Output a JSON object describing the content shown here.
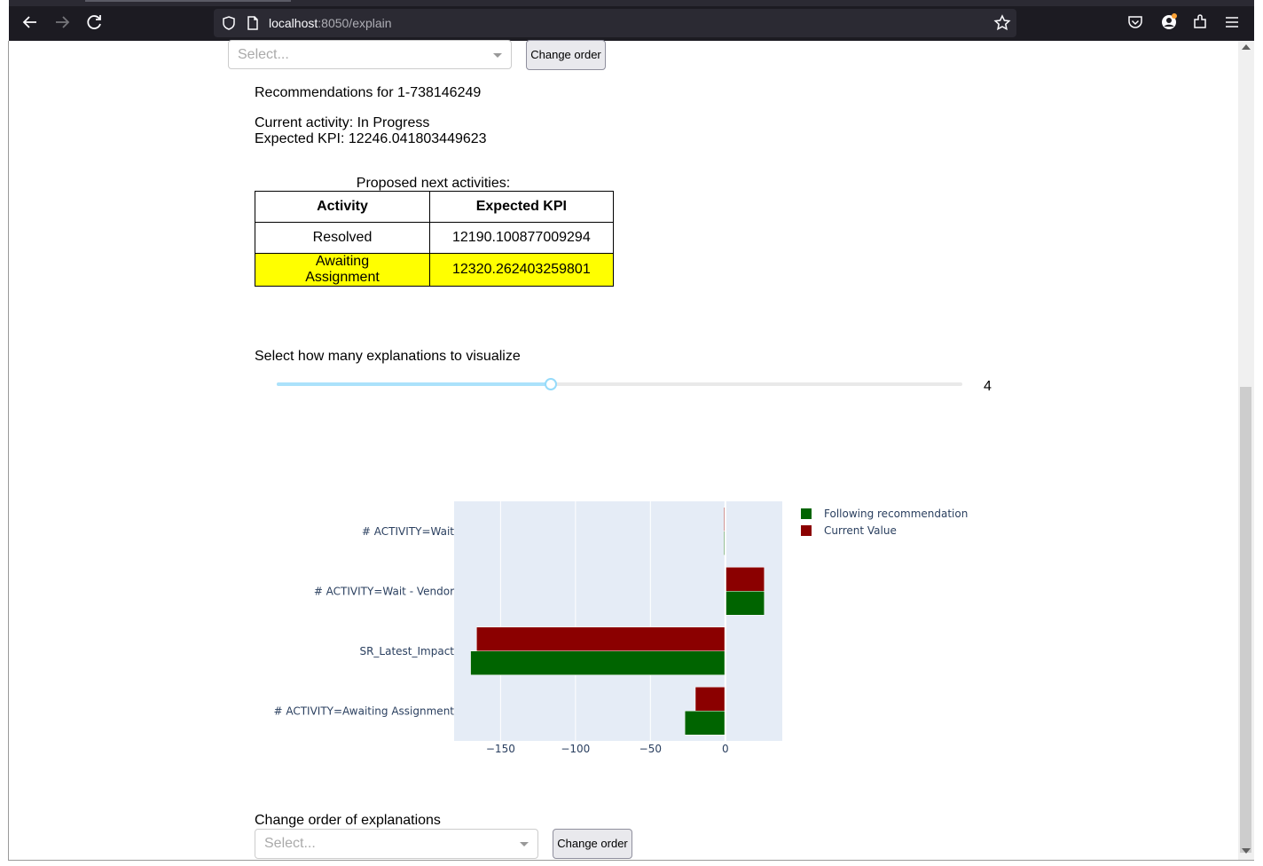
{
  "browser": {
    "url_host": "localhost",
    "url_path": ":8050/explain"
  },
  "top_controls": {
    "select_placeholder": "Select...",
    "change_order_label": "Change order"
  },
  "recommendation": {
    "title": "Recommendations for 1-738146249",
    "current_activity": "Current activity: In Progress",
    "expected_kpi": "Expected KPI: 12246.041803449623",
    "table_caption": "Proposed next activities:",
    "table_headers": [
      "Activity",
      "Expected KPI"
    ],
    "table_rows": [
      {
        "activity": "Resolved",
        "kpi": "12190.100877009294",
        "highlight": false
      },
      {
        "activity": "Awaiting Assignment",
        "kpi": "12320.262403259801",
        "highlight": true
      }
    ],
    "highlight_color": "#ffff00"
  },
  "slider": {
    "label": "Select how many explanations to visualize",
    "value": "4",
    "fraction": 0.4
  },
  "chart_data": {
    "type": "bar",
    "orientation": "horizontal",
    "categories": [
      "# ACTIVITY=Wait",
      "# ACTIVITY=Wait - Vendor",
      "SR_Latest_Impact",
      "# ACTIVITY=Awaiting Assignment"
    ],
    "series": [
      {
        "name": "Following recommendation",
        "color": "#006400",
        "values": [
          -1,
          26,
          -170,
          -27
        ]
      },
      {
        "name": "Current Value",
        "color": "#8b0000",
        "values": [
          -1,
          26,
          -166,
          -20
        ]
      }
    ],
    "xticks": [
      "−150",
      "−100",
      "−50",
      "0"
    ],
    "tick_values": [
      -150,
      -100,
      -50,
      0
    ],
    "xlim": [
      -181,
      38
    ],
    "grid": true,
    "legend_position": "top-right"
  },
  "bottom_controls": {
    "label": "Change order of explanations",
    "select_placeholder": "Select...",
    "change_order_label": "Change order"
  }
}
